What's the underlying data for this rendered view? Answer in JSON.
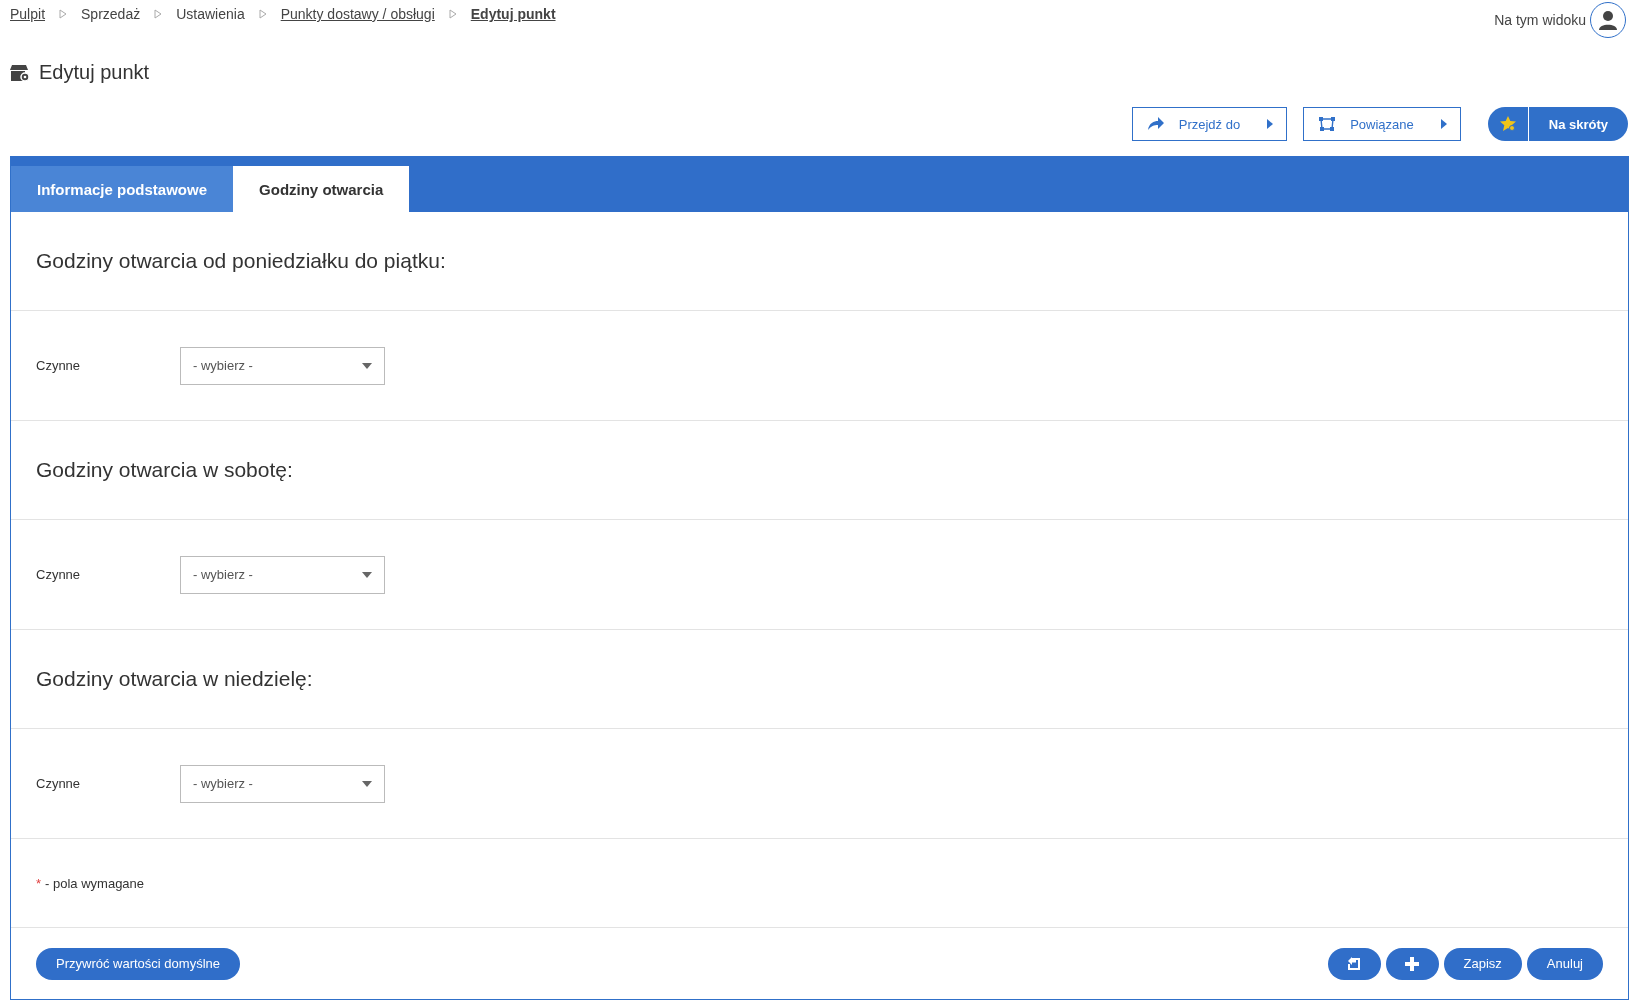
{
  "breadcrumbs": [
    {
      "label": "Pulpit",
      "kind": "link"
    },
    {
      "label": "Sprzedaż",
      "kind": "plain"
    },
    {
      "label": "Ustawienia",
      "kind": "plain"
    },
    {
      "label": "Punkty dostawy / obsługi",
      "kind": "link"
    },
    {
      "label": "Edytuj punkt",
      "kind": "current"
    }
  ],
  "view_label": "Na tym widoku",
  "page_title": "Edytuj punkt",
  "toolbar": {
    "goto": "Przejdź do",
    "related": "Powiązane",
    "shortcuts": "Na skróty"
  },
  "tabs": [
    {
      "label": "Informacje podstawowe",
      "selected": false
    },
    {
      "label": "Godziny otwarcia",
      "selected": true
    }
  ],
  "sections": [
    {
      "heading": "Godziny otwarcia od poniedziałku do piątku:",
      "field_label": "Czynne",
      "placeholder": "- wybierz -"
    },
    {
      "heading": "Godziny otwarcia w sobotę:",
      "field_label": "Czynne",
      "placeholder": "- wybierz -"
    },
    {
      "heading": "Godziny otwarcia w niedzielę:",
      "field_label": "Czynne",
      "placeholder": "- wybierz -"
    }
  ],
  "required_note": {
    "marker": "*",
    "text": "- pola wymagane"
  },
  "footer": {
    "reset": "Przywróć wartości domyślne",
    "save": "Zapisz",
    "cancel": "Anuluj"
  }
}
